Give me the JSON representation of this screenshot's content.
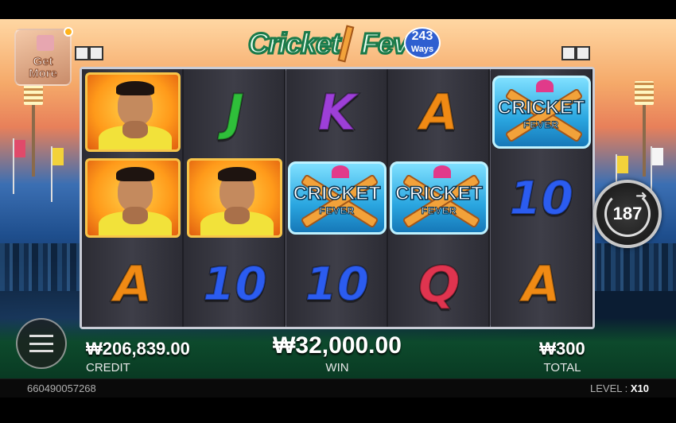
{
  "game": {
    "title_word1": "Cricket",
    "title_word2": "Fever",
    "ways_count": "243",
    "ways_label": "Ways"
  },
  "get_more": {
    "label_line1": "Get",
    "label_line2": "More"
  },
  "spin": {
    "auto_count": "187"
  },
  "reels": [
    [
      "player",
      "player",
      "A"
    ],
    [
      "J",
      "player",
      "10"
    ],
    [
      "K",
      "scatter",
      "10"
    ],
    [
      "A",
      "scatter",
      "Q"
    ],
    [
      "scatter",
      "10",
      "A"
    ]
  ],
  "scatter_text": {
    "line1": "CRICKET",
    "line2": "FEVER"
  },
  "balance": {
    "credit_value": "₩206,839.00",
    "credit_label": "CREDIT",
    "win_value": "₩32,000.00",
    "win_label": "WIN",
    "total_value": "₩300",
    "total_label": "TOTAL"
  },
  "footer": {
    "session_id": "660490057268",
    "level_label": "LEVEL :",
    "level_value": "X10"
  },
  "colors": {
    "J": "#2fbf3a",
    "K": "#9d3fd8",
    "A": "#f08a14",
    "10": "#2b5cf0",
    "Q": "#e0344f"
  }
}
